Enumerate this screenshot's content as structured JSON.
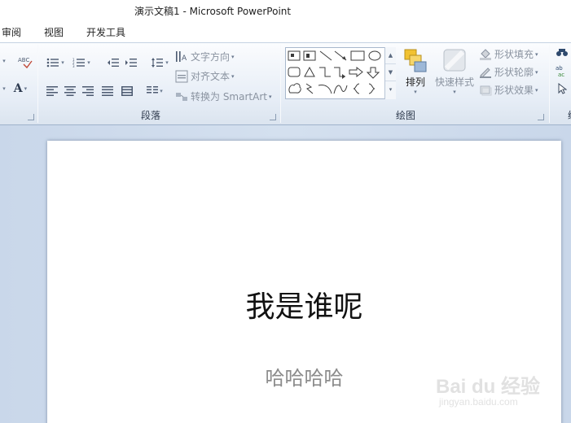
{
  "window": {
    "title": "演示文稿1  -  Microsoft PowerPoint"
  },
  "tabs": [
    {
      "label": "审阅"
    },
    {
      "label": "视图"
    },
    {
      "label": "开发工具"
    }
  ],
  "ribbon": {
    "paragraph": {
      "label": "段落",
      "text_direction": "文字方向",
      "align_text": "对齐文本",
      "convert_smartart": "转换为 SmartArt"
    },
    "font": {
      "font_color_glyph": "A",
      "clear_format_glyph": "ABC"
    },
    "drawing": {
      "label": "绘图",
      "arrange": "排列",
      "quick_styles": "快速样式",
      "shape_fill": "形状填充",
      "shape_outline": "形状轮廓",
      "shape_effects": "形状效果"
    },
    "editing": {
      "partial_label": "编"
    }
  },
  "slide": {
    "title": "我是谁呢",
    "subtitle": "哈哈哈哈"
  },
  "watermark": {
    "line1": "Bai du 经验",
    "line2": "jingyan.baidu.com"
  },
  "colors": {
    "ribbon_bg": "#e6edf6",
    "workspace_bg": "#cdd9ea",
    "subtitle": "#8c8c8c"
  }
}
